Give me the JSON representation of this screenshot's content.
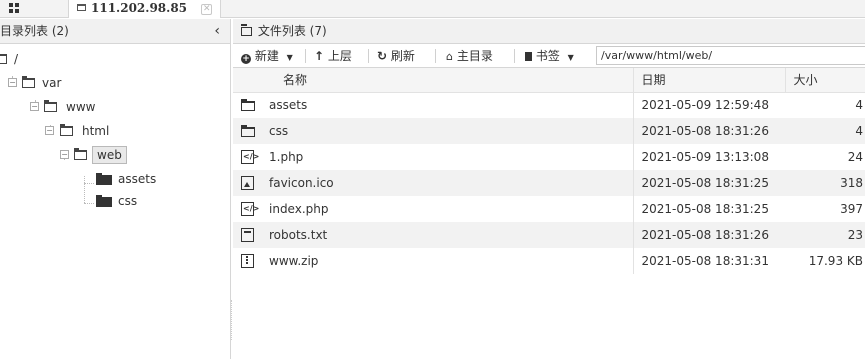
{
  "tabs": [
    {
      "label": "111.202.98.85",
      "icon": "folder-icon",
      "active": true
    }
  ],
  "left_panel": {
    "title": "目录列表 (2)",
    "collapse_glyph": "‹",
    "tree": [
      {
        "label": "/",
        "depth": 0
      },
      {
        "label": "var",
        "depth": 1,
        "toggle": "−"
      },
      {
        "label": "www",
        "depth": 2,
        "toggle": "−"
      },
      {
        "label": "html",
        "depth": 3,
        "toggle": "−"
      },
      {
        "label": "web",
        "depth": 4,
        "toggle": "−",
        "selected": true
      },
      {
        "label": "assets",
        "depth": 5
      },
      {
        "label": "css",
        "depth": 5
      }
    ]
  },
  "right_panel": {
    "title": "文件列表 (7)",
    "toolbar": {
      "new_label": "新建",
      "up_label": "上层",
      "refresh_label": "刷新",
      "home_label": "主目录",
      "bookmark_label": "书签",
      "path_value": "/var/www/html/web/"
    },
    "columns": {
      "name": "名称",
      "date": "日期",
      "size": "大小"
    },
    "files": [
      {
        "name": "assets",
        "type": "folder",
        "date": "2021-05-09 12:59:48",
        "size": "4"
      },
      {
        "name": "css",
        "type": "folder",
        "date": "2021-05-08 18:31:26",
        "size": "4"
      },
      {
        "name": "1.php",
        "type": "code",
        "date": "2021-05-09 13:13:08",
        "size": "24"
      },
      {
        "name": "favicon.ico",
        "type": "image",
        "date": "2021-05-08 18:31:25",
        "size": "318"
      },
      {
        "name": "index.php",
        "type": "code",
        "date": "2021-05-08 18:31:25",
        "size": "397"
      },
      {
        "name": "robots.txt",
        "type": "text",
        "date": "2021-05-08 18:31:26",
        "size": "23"
      },
      {
        "name": "www.zip",
        "type": "archive",
        "date": "2021-05-08 18:31:31",
        "size": "17.93 KB"
      }
    ]
  }
}
